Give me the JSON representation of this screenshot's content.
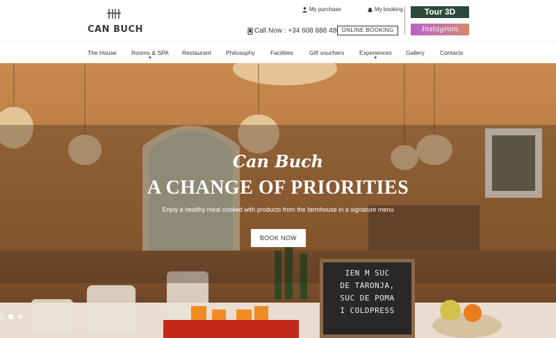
{
  "brand": {
    "name": "CAN BUCH"
  },
  "top_links": {
    "purchase": "My purchase",
    "booking": "My booking"
  },
  "contact": {
    "call_label": "Call Now : +34 608 888 480",
    "online_booking": "ONLINE BOOKING"
  },
  "buttons": {
    "tour": "Tour 3D",
    "instagram": "Instagram"
  },
  "nav": [
    {
      "label": "The House",
      "has_submenu": false
    },
    {
      "label": "Rooms & SPA",
      "has_submenu": true
    },
    {
      "label": "Restaurant",
      "has_submenu": false
    },
    {
      "label": "Philosophy",
      "has_submenu": false
    },
    {
      "label": "Facilities",
      "has_submenu": false
    },
    {
      "label": "Gift vouchers",
      "has_submenu": false
    },
    {
      "label": "Experiences",
      "has_submenu": true
    },
    {
      "label": "Gallery",
      "has_submenu": false
    },
    {
      "label": "Contacts",
      "has_submenu": false
    }
  ],
  "hero": {
    "script": "Can Buch",
    "title": "A CHANGE OF PRIORITIES",
    "subtitle": "Enjoy a healthy meal cooked with products from the farmhouse in a signature menu",
    "cta": "BOOK NOW",
    "chalkboard": [
      "IEN M   SUC",
      "DE TARONJA,",
      "SUC DE POMA",
      "I  COLDPRESS"
    ],
    "active_slide": 2,
    "slide_count": 3
  },
  "colors": {
    "tour_bg": "#2b4a3a",
    "instagram_gradient": [
      "#b760c6",
      "#d9866a"
    ],
    "text": "#333333"
  },
  "icons": {
    "purchase": "user-icon",
    "booking": "bell-icon",
    "call": "phone-icon",
    "submenu": "chevron-down-icon"
  }
}
